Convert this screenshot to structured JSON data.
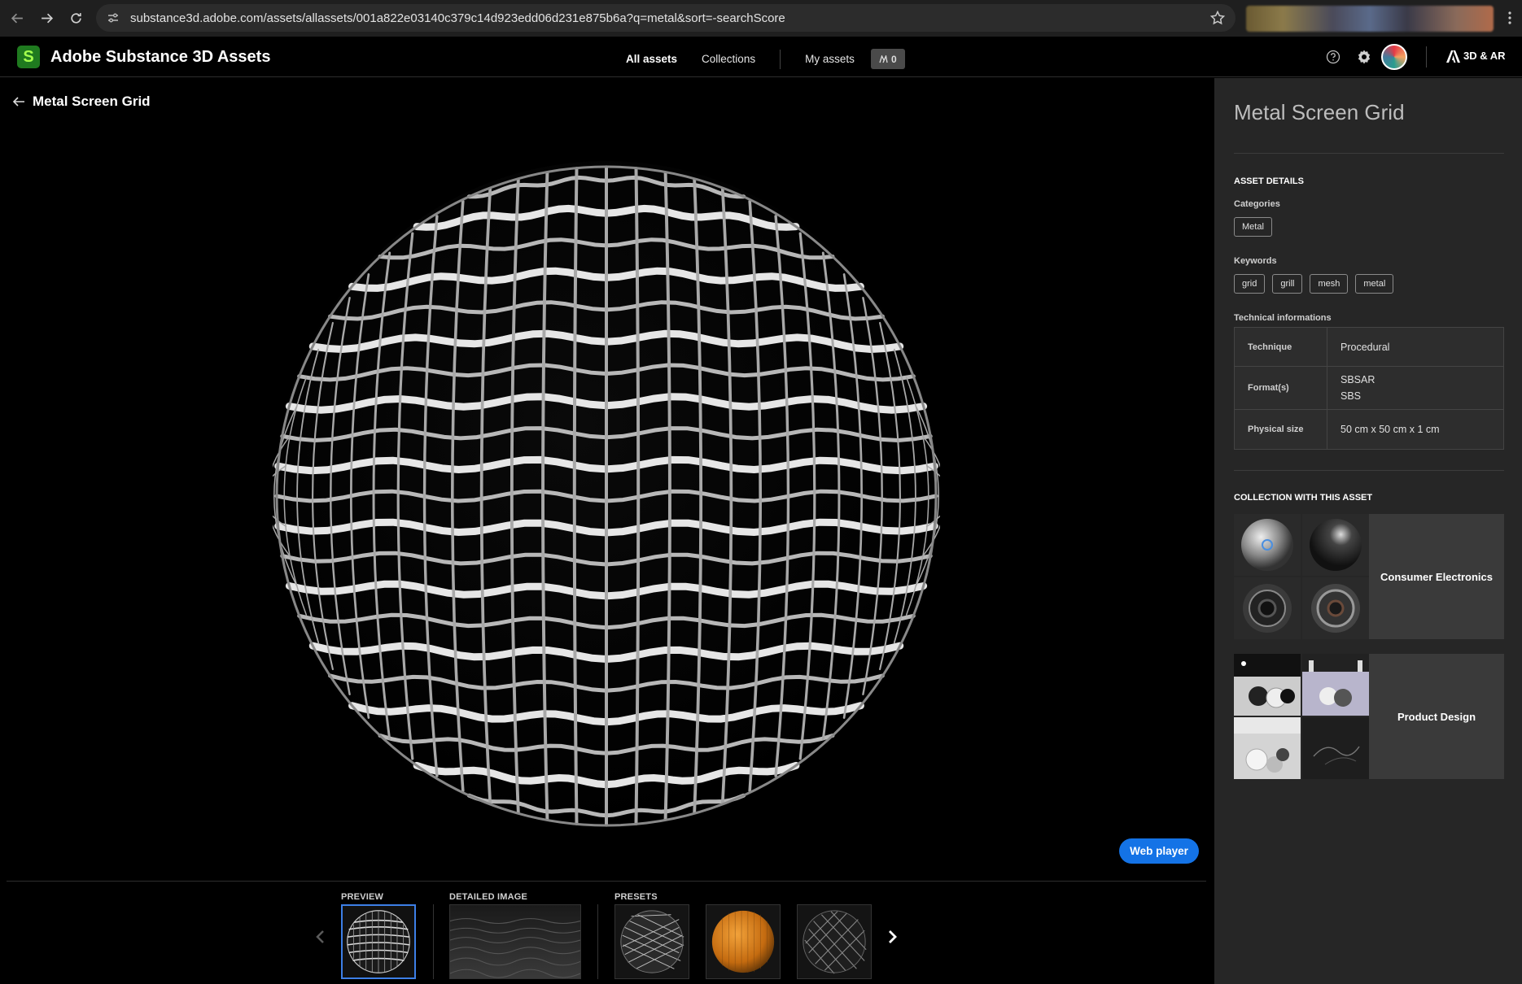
{
  "browser": {
    "url": "substance3d.adobe.com/assets/allassets/001a822e03140c379c14d923edd06d231e875b6a?q=metal&sort=-searchScore"
  },
  "header": {
    "app_title": "Adobe Substance 3D Assets",
    "logo_letter": "S",
    "nav": {
      "all_assets": "All assets",
      "collections": "Collections",
      "my_assets": "My assets",
      "credits": "0"
    },
    "brand_label": "3D & AR"
  },
  "viewer": {
    "asset_title": "Metal Screen Grid",
    "web_player_label": "Web player"
  },
  "strip": {
    "preview_label": "PREVIEW",
    "detailed_label": "DETAILED IMAGE",
    "presets_label": "PRESETS"
  },
  "panel": {
    "title": "Metal Screen Grid",
    "asset_details_label": "ASSET DETAILS",
    "categories_label": "Categories",
    "categories": [
      "Metal"
    ],
    "keywords_label": "Keywords",
    "keywords": [
      "grid",
      "grill",
      "mesh",
      "metal"
    ],
    "tech_label": "Technical informations",
    "tech": [
      {
        "key": "Technique",
        "values": [
          "Procedural"
        ]
      },
      {
        "key": "Format(s)",
        "values": [
          "SBSAR",
          "SBS"
        ]
      },
      {
        "key": "Physical size",
        "values": [
          "50 cm x 50 cm x 1 cm"
        ]
      }
    ],
    "collection_label": "COLLECTION WITH THIS ASSET",
    "collections": [
      "Consumer Electronics",
      "Product Design"
    ]
  },
  "colors": {
    "accent_blue": "#1473e6",
    "panel_bg": "#262626",
    "logo_green": "#1f7a1f"
  }
}
